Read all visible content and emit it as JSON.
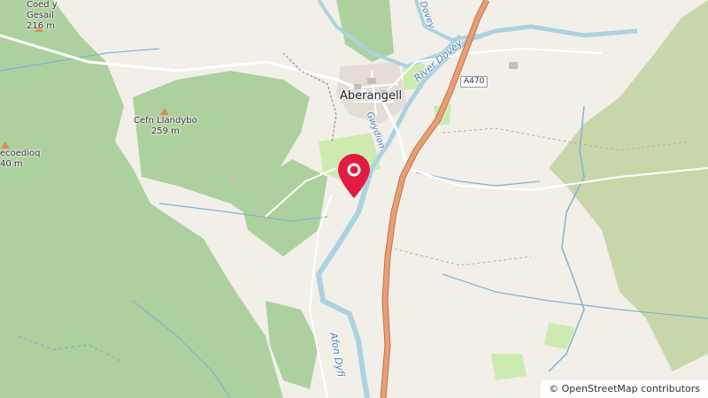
{
  "map": {
    "place_labels": {
      "aberangell": "Aberangell",
      "coed_y_gesail": "Coed y\nGesail\n216 m",
      "cefn_llandybo": "Cefn Llandybo\n259 m",
      "pecoediog": "ecoedioq\n40 m"
    },
    "river_labels": {
      "river_dovey": "River Dovey",
      "gwydion": "Gwydion",
      "afon_dyfi": "Afon Dyfi",
      "dovey_top": "Dovey"
    },
    "road_labels": {
      "a470": "A470"
    },
    "marker": {
      "name": "location-marker",
      "color": "#e21b40"
    },
    "attribution": "© OpenStreetMap contributors",
    "colors": {
      "land": "#f2efe9",
      "forest": "#add19e",
      "grass": "#cdebb0",
      "scrub": "#c8d7ab",
      "water": "#aad3df",
      "river_line": "#7fb2d0",
      "trunk_road": "#e89f74",
      "trunk_road_casing": "#c0724a"
    }
  }
}
